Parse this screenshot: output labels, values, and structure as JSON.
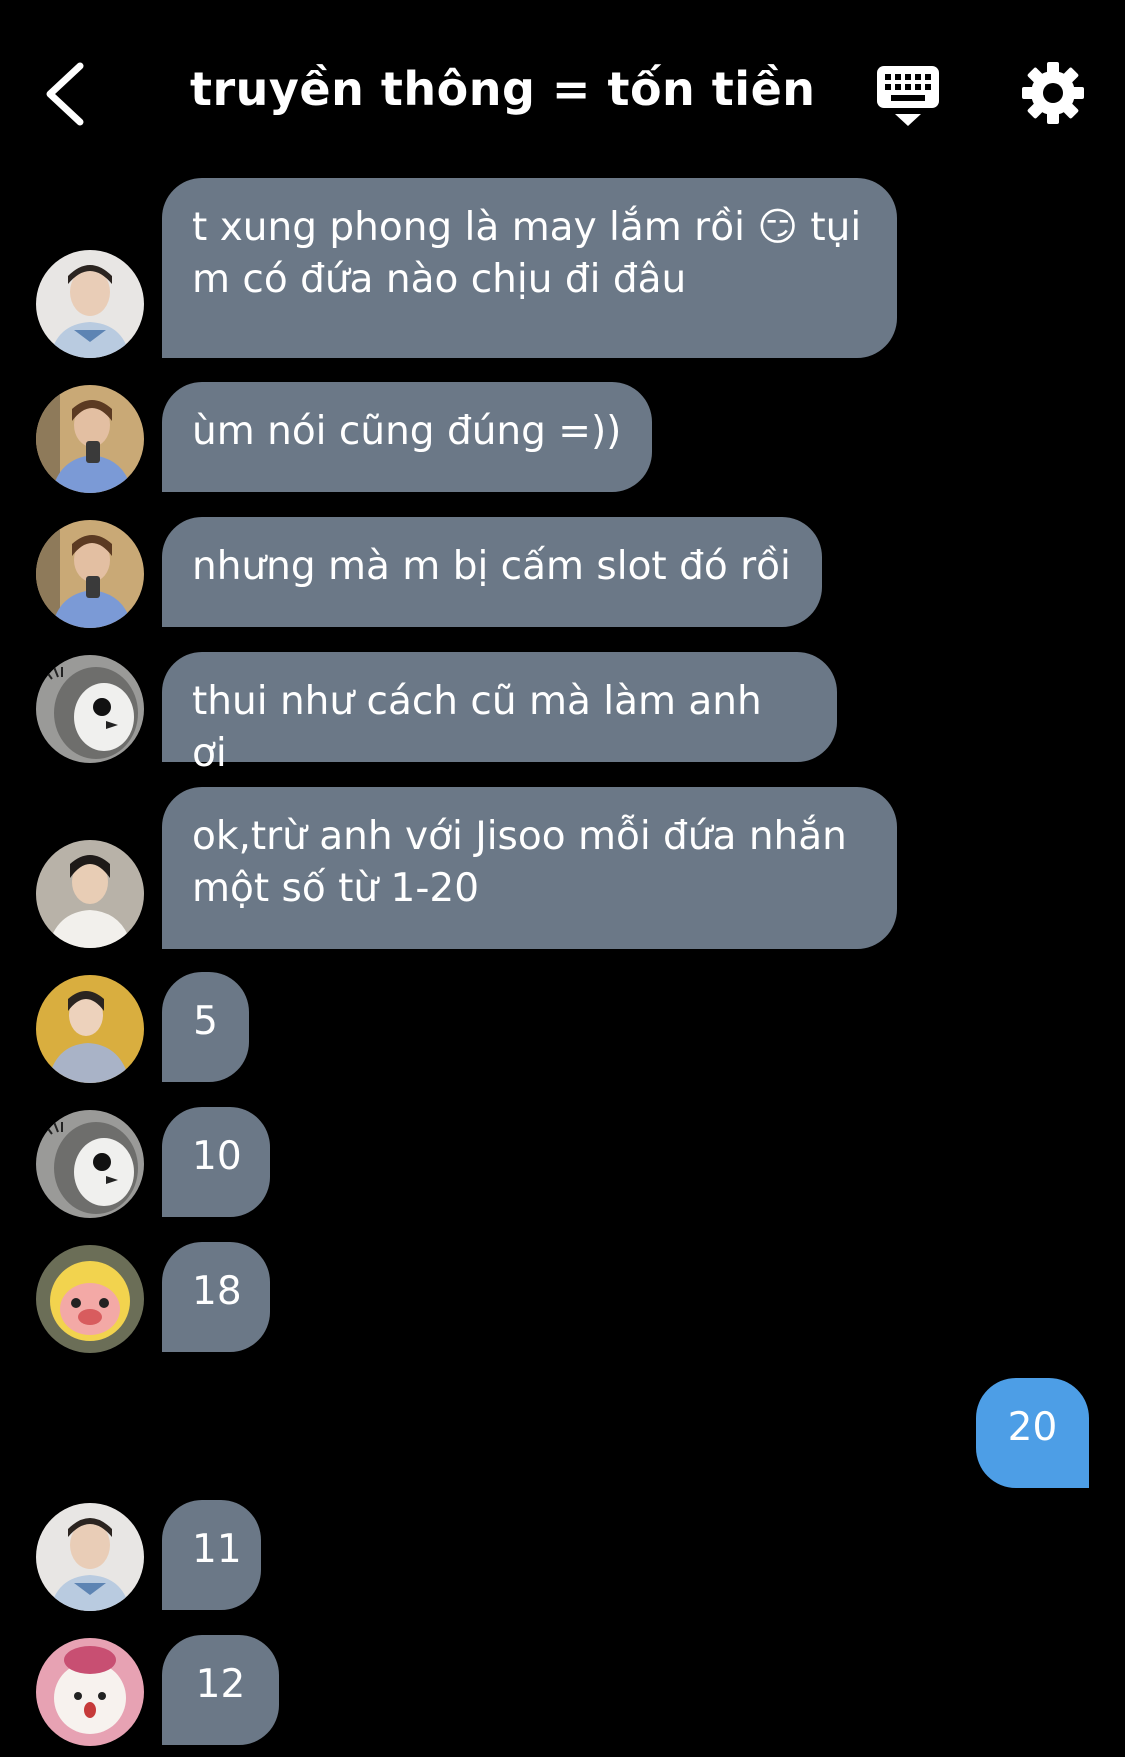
{
  "header": {
    "title": "truyền thông = tốn tiền",
    "back_icon": "chevron-left-icon",
    "keyboard_icon": "keyboard-icon",
    "settings_icon": "gear-icon"
  },
  "colors": {
    "background": "#000000",
    "bubble_received": "#6b7887",
    "bubble_sent": "#4d9ee6",
    "text": "#ffffff"
  },
  "messages": [
    {
      "sender": "other",
      "avatar": "avatar-1",
      "text": "t xung phong là may lắm rồi 😏 tụi\nm có đứa nào chịu đi đâu"
    },
    {
      "sender": "other",
      "avatar": "avatar-2",
      "text": "ùm nói cũng đúng =))"
    },
    {
      "sender": "other",
      "avatar": "avatar-2",
      "text": "nhưng mà m bị cấm slot đó rồi"
    },
    {
      "sender": "other",
      "avatar": "avatar-3",
      "text": "thui như cách cũ mà làm anh ơi"
    },
    {
      "sender": "other",
      "avatar": "avatar-4",
      "text": "ok,trừ anh với Jisoo mỗi đứa nhắn\nmột số từ 1-20"
    },
    {
      "sender": "other",
      "avatar": "avatar-5",
      "text": "5"
    },
    {
      "sender": "other",
      "avatar": "avatar-3",
      "text": "10"
    },
    {
      "sender": "other",
      "avatar": "avatar-6",
      "text": "18"
    },
    {
      "sender": "me",
      "text": "20"
    },
    {
      "sender": "other",
      "avatar": "avatar-1",
      "text": "11"
    },
    {
      "sender": "other",
      "avatar": "avatar-7",
      "text": "12"
    }
  ]
}
